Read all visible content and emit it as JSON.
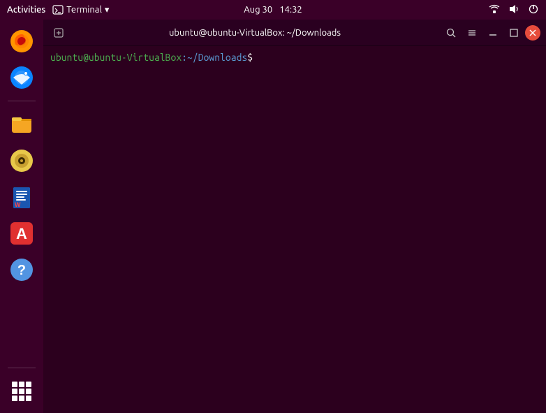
{
  "topbar": {
    "activities_label": "Activities",
    "terminal_label": "Terminal",
    "date": "Aug 30",
    "time": "14:32"
  },
  "sidebar": {
    "items": [
      {
        "name": "firefox",
        "label": "Firefox"
      },
      {
        "name": "thunderbird",
        "label": "Thunderbird"
      },
      {
        "name": "files",
        "label": "Files"
      },
      {
        "name": "rhythmbox",
        "label": "Rhythmbox"
      },
      {
        "name": "libreoffice-writer",
        "label": "LibreOffice Writer"
      },
      {
        "name": "app-center",
        "label": "App Center"
      },
      {
        "name": "help",
        "label": "Help"
      }
    ],
    "grid_label": "Show Applications"
  },
  "terminal": {
    "title": "ubuntu@ubuntu-VirtualBox: ~/Downloads",
    "prompt_user": "ubuntu@ubuntu-VirtualBox",
    "prompt_path": ":~/Downloads",
    "prompt_dollar": "$"
  }
}
